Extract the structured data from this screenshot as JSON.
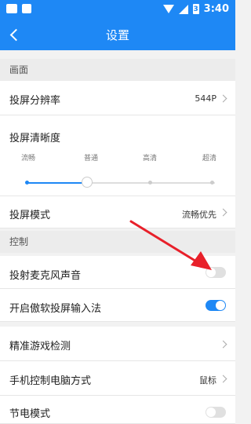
{
  "status_bar": {
    "time": "3:40",
    "battery_glyph": "3"
  },
  "header": {
    "title": "设置"
  },
  "sections": {
    "picture": "画面",
    "control": "控制"
  },
  "picture": {
    "resolution": {
      "label": "投屏分辨率",
      "value": "544P"
    },
    "clarity": {
      "label": "投屏清晰度",
      "levels": [
        "流畅",
        "普通",
        "高清",
        "超清"
      ],
      "selected_index": 1
    },
    "mode": {
      "label": "投屏模式",
      "value": "流畅优先"
    }
  },
  "control": {
    "mic_sound": {
      "label": "投射麦克风声音",
      "enabled": false
    },
    "ime": {
      "label": "开启傲软投屏输入法",
      "enabled": true
    },
    "game_detect": {
      "label": "精准游戏检测"
    },
    "phone_control": {
      "label": "手机控制电脑方式",
      "value": "鼠标"
    },
    "power_save": {
      "label": "节电模式",
      "enabled": false
    }
  },
  "colors": {
    "accent": "#1e88f5",
    "annotation_arrow": "#e8202a"
  },
  "icons": [
    "image-icon",
    "notification-icon",
    "wifi-icon",
    "signal-icon",
    "battery-icon",
    "back-arrow-icon",
    "chevron-right-icon"
  ]
}
